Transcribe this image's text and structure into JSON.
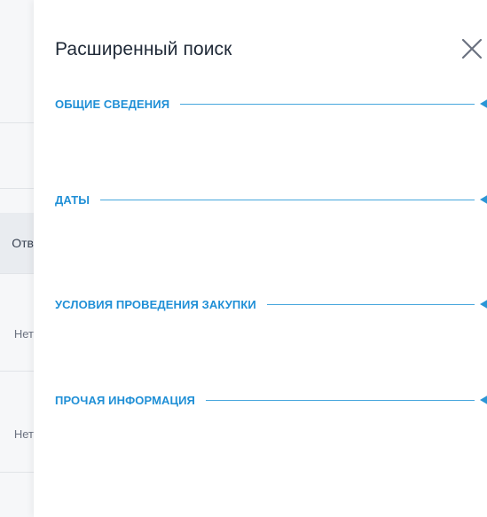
{
  "background": {
    "header_fragment": "Отв",
    "row_fragments": [
      "Нет",
      "Нет"
    ]
  },
  "drawer": {
    "title": "Расширенный поиск",
    "close_icon": "close-icon",
    "accent_color": "#1f8fd6",
    "sections": [
      {
        "label": "ОБЩИЕ СВЕДЕНИЯ",
        "expanded": false
      },
      {
        "label": "ДАТЫ",
        "expanded": false
      },
      {
        "label": "УСЛОВИЯ ПРОВЕДЕНИЯ ЗАКУПКИ",
        "expanded": false
      },
      {
        "label": "ПРОЧАЯ ИНФОРМАЦИЯ",
        "expanded": false
      }
    ]
  }
}
